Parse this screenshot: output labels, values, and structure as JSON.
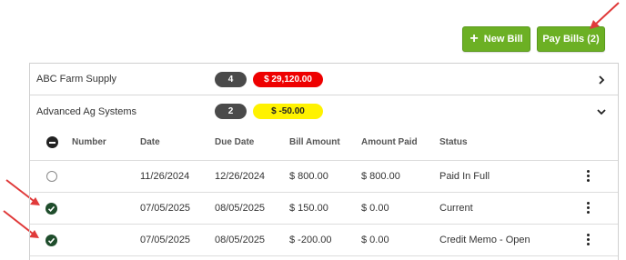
{
  "toolbar": {
    "new_bill_label": "New Bill",
    "new_bill_icon": "plus-icon",
    "pay_bills_label": "Pay Bills (2)",
    "button_color": "#6cb024"
  },
  "vendors": [
    {
      "name": "ABC Farm Supply",
      "count": "4",
      "amount": "$ 29,120.00",
      "amount_color": "#ee0000",
      "expanded": false,
      "chevron_icon": "chevron-right-icon"
    },
    {
      "name": "Advanced Ag Systems",
      "count": "2",
      "amount": "$ -50.00",
      "amount_color": "#fff200",
      "expanded": true,
      "chevron_icon": "chevron-down-icon"
    }
  ],
  "table": {
    "columns": [
      "Number",
      "Date",
      "Due Date",
      "Bill Amount",
      "Amount Paid",
      "Status"
    ],
    "rows": [
      {
        "selected": false,
        "number": "",
        "date": "11/26/2024",
        "due_date": "12/26/2024",
        "bill_amount": "$ 800.00",
        "amount_paid": "$ 800.00",
        "status": "Paid In Full"
      },
      {
        "selected": true,
        "number": "",
        "date": "07/05/2025",
        "due_date": "08/05/2025",
        "bill_amount": "$ 150.00",
        "amount_paid": "$ 0.00",
        "status": "Current"
      },
      {
        "selected": true,
        "number": "",
        "date": "07/05/2025",
        "due_date": "08/05/2025",
        "bill_amount": "$ -200.00",
        "amount_paid": "$ 0.00",
        "status": "Credit Memo - Open"
      }
    ]
  },
  "annotation_color": "#e03a3a"
}
